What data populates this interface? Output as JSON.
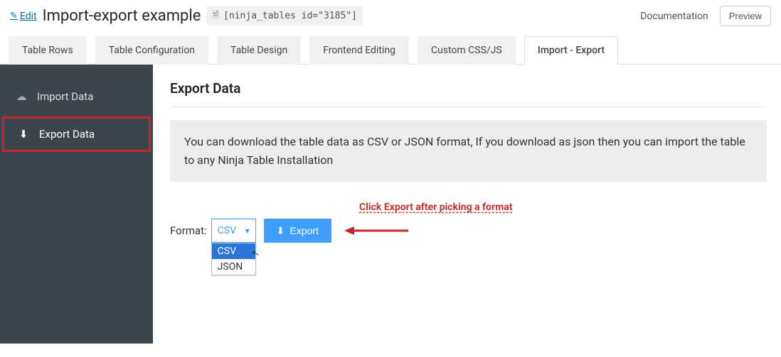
{
  "header": {
    "edit_label": "Edit",
    "page_title": "Import-export example",
    "shortcode_text": "[ninja_tables id=\"3185\"]",
    "documentation_label": "Documentation",
    "preview_button": "Preview"
  },
  "tabs": [
    {
      "label": "Table Rows",
      "active": false
    },
    {
      "label": "Table Configuration",
      "active": false
    },
    {
      "label": "Table Design",
      "active": false
    },
    {
      "label": "Frontend Editing",
      "active": false
    },
    {
      "label": "Custom CSS/JS",
      "active": false
    },
    {
      "label": "Import - Export",
      "active": true
    }
  ],
  "sidebar": [
    {
      "icon_name": "cloud-upload",
      "label": "Import Data",
      "active": false
    },
    {
      "icon_name": "download",
      "label": "Export Data",
      "active": true
    }
  ],
  "main": {
    "section_title": "Export Data",
    "notice_text": "You can download the table data as CSV or JSON format, If you download as json then you can import the table to any Ninja Table Installation",
    "annotation_text": "Click Export after picking a format",
    "format_label": "Format:",
    "select": {
      "selected": "CSV",
      "options": [
        "CSV",
        "JSON"
      ]
    },
    "export_button": "Export"
  }
}
